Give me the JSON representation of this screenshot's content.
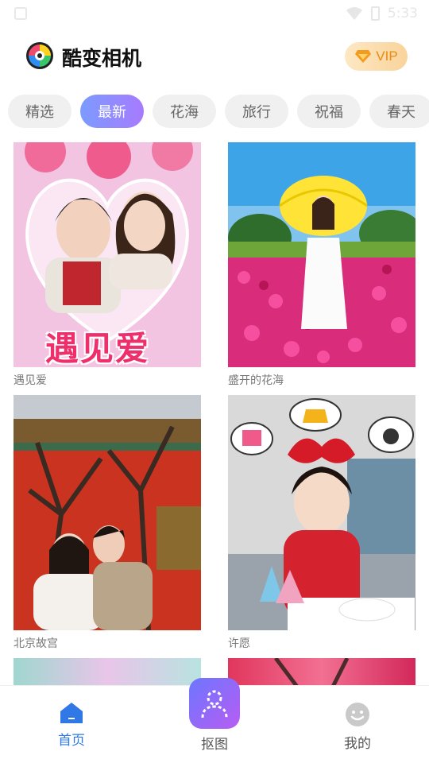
{
  "status_bar": {
    "time": "5:33"
  },
  "header": {
    "app_title": "酷变相机",
    "vip_label": "VIP"
  },
  "tabs": [
    {
      "label": "精选",
      "active": false
    },
    {
      "label": "最新",
      "active": true
    },
    {
      "label": "花海",
      "active": false
    },
    {
      "label": "旅行",
      "active": false
    },
    {
      "label": "祝福",
      "active": false
    },
    {
      "label": "春天",
      "active": false
    }
  ],
  "cards": [
    {
      "caption": "遇见爱",
      "overlay_text": "遇见爱"
    },
    {
      "caption": "盛开的花海"
    },
    {
      "caption": "北京故宫"
    },
    {
      "caption": "许愿"
    }
  ],
  "bottom_nav": {
    "home_label": "首页",
    "cutout_label": "抠图",
    "mine_label": "我的"
  },
  "colors": {
    "accent_blue": "#2f78e6",
    "vip_text": "#e98a15"
  }
}
